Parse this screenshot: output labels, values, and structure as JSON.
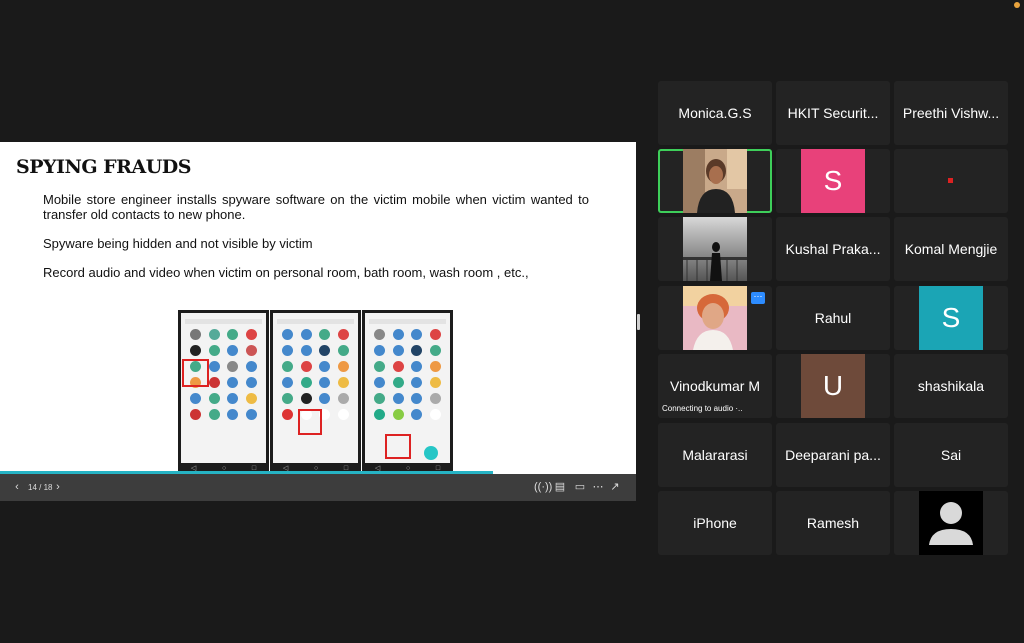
{
  "slide": {
    "title": "SPYING FRAUDS",
    "bullets": [
      "Mobile store engineer installs spyware software on the victim mobile when victim wanted to transfer old contacts to new phone.",
      "Spyware being hidden and not visible by victim",
      "Record audio and video when victim on personal room, bath room, wash room , etc.,"
    ]
  },
  "slide_toolbar": {
    "page_counter": "14 / 18",
    "prev_icon": "chevron-left-icon",
    "next_icon": "chevron-right-icon",
    "right_icons": [
      "audio-icon",
      "captions-icon",
      "present-icon",
      "more-icon",
      "fullscreen-icon"
    ]
  },
  "participants": [
    {
      "name": "Monica.G.S"
    },
    {
      "name": "HKIT Securit..."
    },
    {
      "name": "Preethi Vishw..."
    },
    {
      "name": "",
      "type": "video",
      "active_speaker": true
    },
    {
      "name": "",
      "avatar_letter": "S",
      "avatar_color": "#e8417a"
    },
    {
      "name": "",
      "type": "muted-video"
    },
    {
      "name": "",
      "type": "photo"
    },
    {
      "name": "Kushal Praka..."
    },
    {
      "name": "Komal Mengjie"
    },
    {
      "name": "",
      "type": "photo"
    },
    {
      "name": "Rahul"
    },
    {
      "name": "",
      "avatar_letter": "S",
      "avatar_color": "#1ba5b5"
    },
    {
      "name": "Vinodkumar M",
      "status": "Connecting to audio"
    },
    {
      "name": "",
      "avatar_letter": "U",
      "avatar_color": "#6e4a3a"
    },
    {
      "name": "shashikala"
    },
    {
      "name": "Malararasi"
    },
    {
      "name": "Deeparani pa..."
    },
    {
      "name": "Sai"
    },
    {
      "name": "iPhone"
    },
    {
      "name": "Ramesh"
    },
    {
      "name": "",
      "type": "default-avatar"
    }
  ],
  "colors": {
    "background": "#1a1a1a",
    "tile": "#232323",
    "active_border": "#3ecf5a",
    "progress": "#26b3c4"
  }
}
